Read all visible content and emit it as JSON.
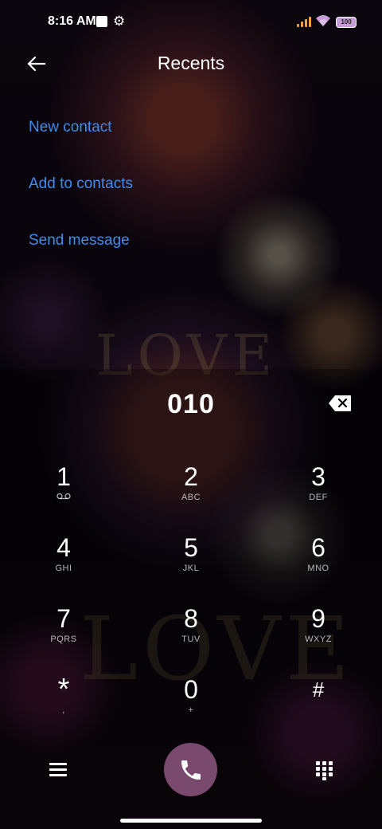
{
  "status_bar": {
    "time": "8:16 AM",
    "battery": "100",
    "icons": [
      "notification-square-icon",
      "settings-gear-icon",
      "signal-icon",
      "wifi-icon",
      "battery-icon"
    ],
    "colors": {
      "signal": "#f0a040",
      "battery_fill": "#c79bd8"
    }
  },
  "header": {
    "title": "Recents",
    "back_icon": "back-arrow-icon"
  },
  "actions": [
    {
      "label": "New contact"
    },
    {
      "label": "Add to contacts"
    },
    {
      "label": "Send message"
    }
  ],
  "accent_color": "#3d8cf0",
  "dialer": {
    "number": "010",
    "backspace_icon": "backspace-icon"
  },
  "keypad": {
    "keys": [
      {
        "digit": "1",
        "sub": "",
        "sub_icon": "voicemail-icon"
      },
      {
        "digit": "2",
        "sub": "ABC"
      },
      {
        "digit": "3",
        "sub": "DEF"
      },
      {
        "digit": "4",
        "sub": "GHI"
      },
      {
        "digit": "5",
        "sub": "JKL"
      },
      {
        "digit": "6",
        "sub": "MNO"
      },
      {
        "digit": "7",
        "sub": "PQRS"
      },
      {
        "digit": "8",
        "sub": "TUV"
      },
      {
        "digit": "9",
        "sub": "WXYZ"
      },
      {
        "digit": "*",
        "sub": ","
      },
      {
        "digit": "0",
        "sub": "+"
      },
      {
        "digit": "#",
        "sub": ""
      }
    ]
  },
  "bottom_bar": {
    "menu_icon": "menu-icon",
    "call_icon": "phone-icon",
    "dialpad_icon": "dialpad-icon",
    "call_button_color": "#7a4a6e"
  }
}
